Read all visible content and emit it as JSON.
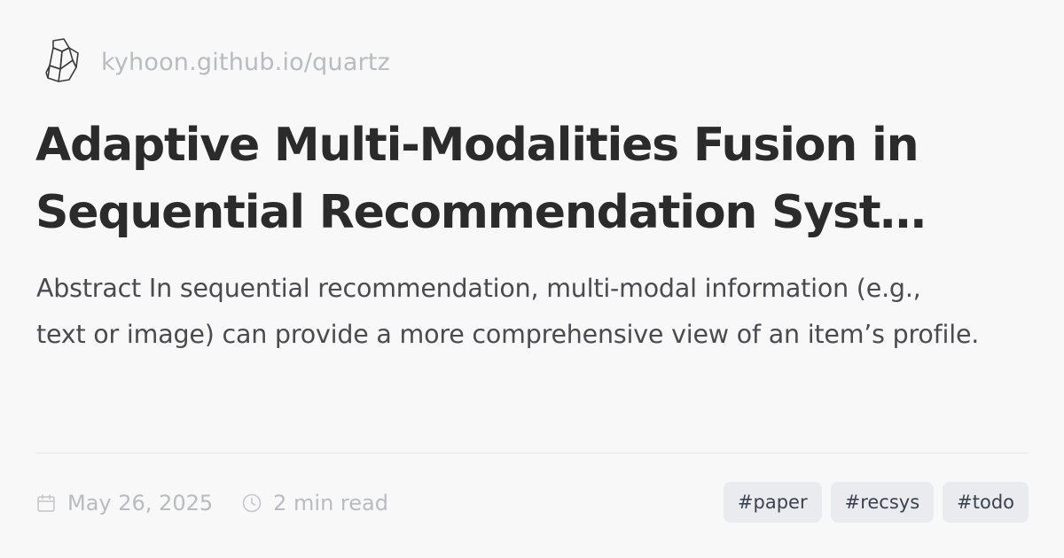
{
  "site": {
    "url": "kyhoon.github.io/quartz",
    "logo_icon": "crystal-icon"
  },
  "post": {
    "title_line1": "Adaptive Multi-Modalities Fusion in",
    "title_line2": "Sequential Recommendation Syst…",
    "abstract_line1": "Abstract In sequential recommendation, multi-modal information (e.g.,",
    "abstract_line2": "text or image) can provide a more comprehensive view of an item’s profile."
  },
  "meta": {
    "date": "May 26, 2025",
    "date_icon": "calendar-icon",
    "read_time": "2 min read",
    "read_icon": "clock-icon"
  },
  "tags": [
    "#paper",
    "#recsys",
    "#todo"
  ],
  "colors": {
    "background": "#f8f8f9",
    "title": "#2b2b2b",
    "muted": "#b9bbc0",
    "tag_bg": "#e9ebee",
    "tag_text": "#3a4250"
  }
}
